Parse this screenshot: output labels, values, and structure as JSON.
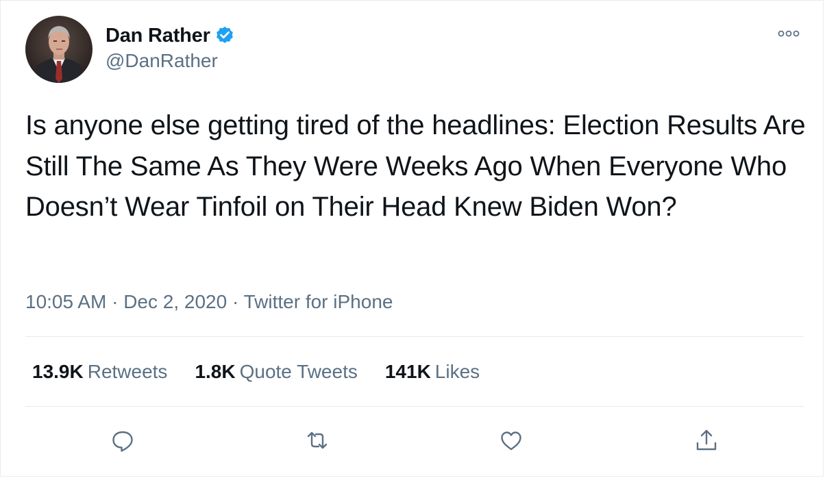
{
  "author": {
    "display_name": "Dan Rather",
    "handle": "@DanRather",
    "verified_icon": "verified-badge-icon",
    "avatar_icon": "avatar"
  },
  "tweet": {
    "text": "Is anyone else getting tired of the headlines: Election Results Are Still The Same As They Were Weeks Ago When Everyone Who Doesn’t Wear Tinfoil on Their Head Knew Biden Won?",
    "time": "10:05 AM",
    "date": "Dec 2, 2020",
    "source": "Twitter for iPhone",
    "separator": "·"
  },
  "stats": {
    "retweets_count": "13.9K",
    "retweets_label": "Retweets",
    "quotes_count": "1.8K",
    "quotes_label": "Quote Tweets",
    "likes_count": "141K",
    "likes_label": "Likes"
  },
  "actions": [
    "reply-icon",
    "retweet-icon",
    "like-icon",
    "share-icon"
  ],
  "colors": {
    "text_primary": "#0f1419",
    "text_secondary": "#5b7083",
    "verified_blue": "#1da1f2",
    "divider": "#e6ecf0"
  }
}
